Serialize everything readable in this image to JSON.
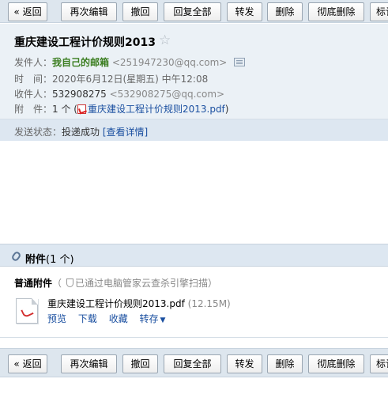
{
  "toolbar": {
    "back": "« 返回",
    "edit_again": "再次编辑",
    "recall": "撤回",
    "reply_all": "回复全部",
    "forward": "转发",
    "delete": "删除",
    "delete_permanent": "彻底删除",
    "mark": "标记"
  },
  "mail": {
    "subject": "重庆建设工程计价规则2013",
    "star_icon": "star-outline-icon",
    "from_label": "发件人：",
    "from_name": "我自己的邮箱",
    "from_addr": "<251947230@qq.com>",
    "time_label": "时　间：",
    "time_value": "2020年6月12日(星期五) 中午12:08",
    "to_label": "收件人：",
    "to_name": "532908275",
    "to_addr": "<532908275@qq.com>",
    "attach_label": "附　件：",
    "attach_count_prefix": "1 个 (",
    "attach_file": "重庆建设工程计价规则2013.pdf",
    "attach_count_suffix": ")"
  },
  "status": {
    "label": "发送状态：",
    "value": "投递成功",
    "details": "[查看详情]"
  },
  "attachments": {
    "title": "附件",
    "count": "(1 个)",
    "kind": "普通附件",
    "scan_note": "已通过电脑管家云查杀引擎扫描",
    "file_name": "重庆建设工程计价规则2013.pdf",
    "file_size": "(12.15M)",
    "actions": {
      "preview": "预览",
      "download": "下载",
      "save": "收藏",
      "forward": "转存"
    }
  },
  "colors": {
    "toolbar_bg": "#dde6ee",
    "header_bg": "#ebf1f6",
    "link": "#1a4fa0",
    "sender_green": "#3a7d1f"
  }
}
